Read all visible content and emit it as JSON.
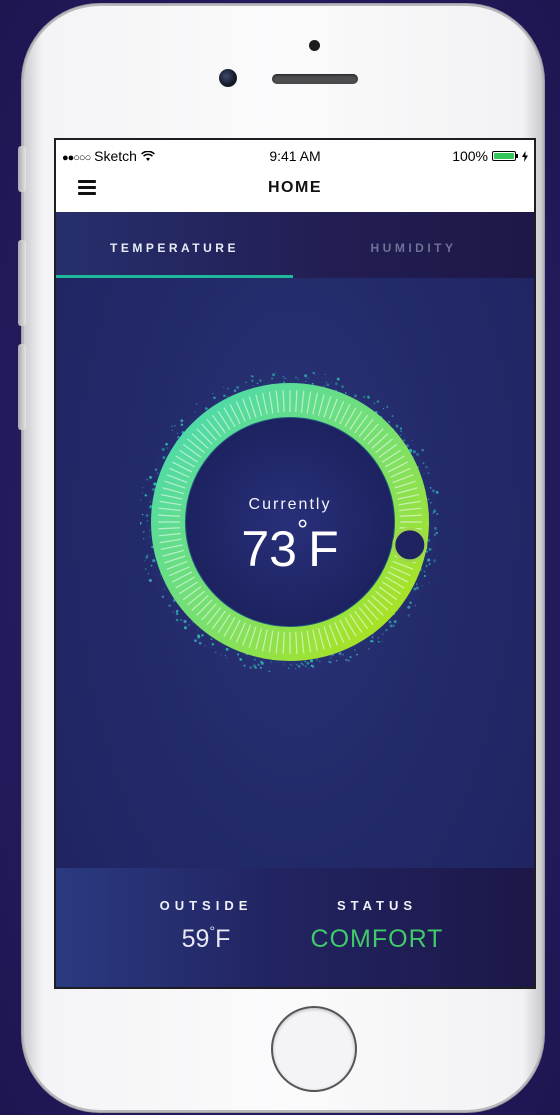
{
  "status_bar": {
    "signal_dots": "●●○○○",
    "carrier": "Sketch",
    "wifi_icon": "wifi-icon",
    "time": "9:41 AM",
    "battery_percent": "100%",
    "battery_level": 1.0,
    "charging_icon": "bolt-icon"
  },
  "navbar": {
    "menu_icon": "hamburger-menu-icon",
    "title": "HOME"
  },
  "tabs": [
    {
      "label": "TEMPERATURE",
      "active": true
    },
    {
      "label": "HUMIDITY",
      "active": false
    }
  ],
  "dial": {
    "label": "Currently",
    "value": "73",
    "degree_symbol": "°",
    "unit": "F",
    "level": 0.78
  },
  "stats": {
    "outside": {
      "label": "OUTSIDE",
      "value": "59",
      "degree_symbol": "°",
      "unit": "F"
    },
    "status": {
      "label": "STATUS",
      "value": "COMFORT"
    }
  },
  "colors": {
    "accent_teal": "#1db99a",
    "ring_start": "#5ee6b8",
    "ring_end": "#a8e61a",
    "comfort_green": "#3ecb6a",
    "background": "#232a6a"
  }
}
